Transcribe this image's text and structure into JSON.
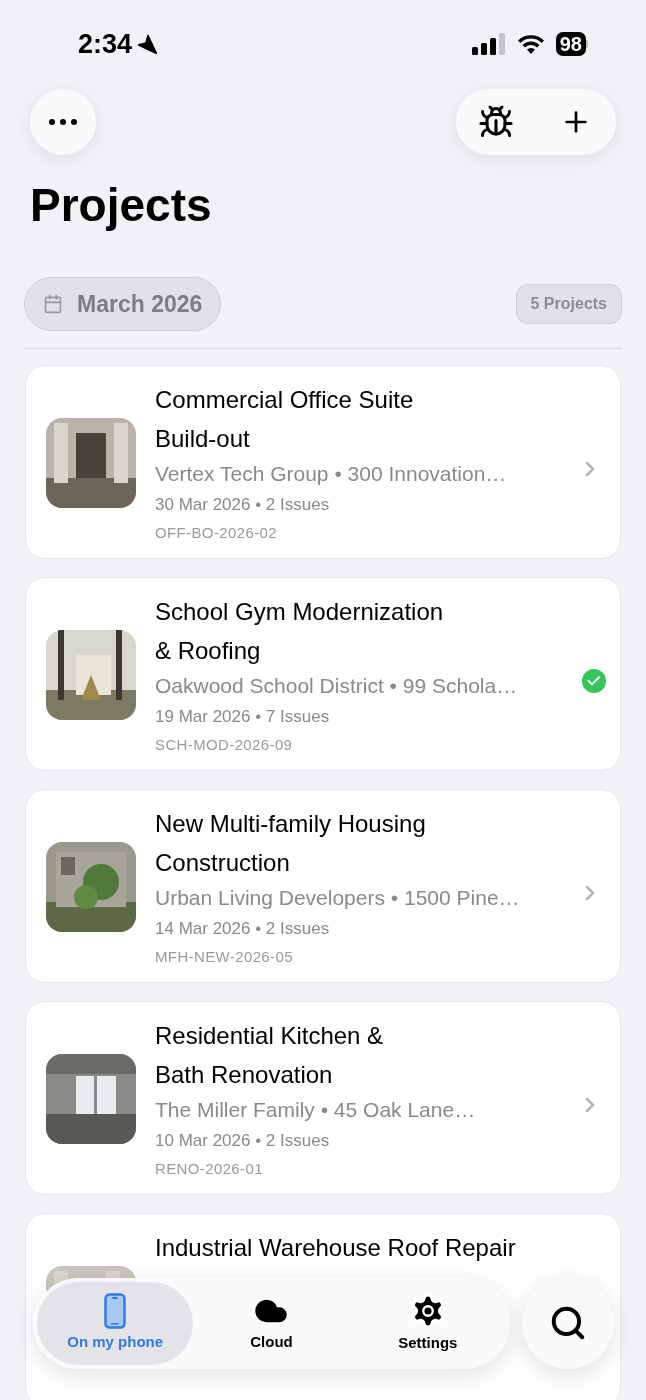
{
  "status_bar": {
    "time": "2:34",
    "battery": "98"
  },
  "title": "Projects",
  "filter": {
    "month": "March 2026",
    "count": "5 Projects"
  },
  "projects": [
    {
      "title": [
        "Commercial Office Suite",
        "Build-out"
      ],
      "subtitle": "Vertex Tech Group • 300 Innovation…",
      "meta": "30 Mar 2026 • 2 Issues",
      "code": "OFF-BO-2026-02",
      "completed": false
    },
    {
      "title": [
        "School Gym Modernization",
        "& Roofing"
      ],
      "subtitle": "Oakwood School District • 99 Schola…",
      "meta": "19 Mar 2026 • 7 Issues",
      "code": "SCH-MOD-2026-09",
      "completed": true
    },
    {
      "title": [
        "New Multi-family Housing",
        "Construction"
      ],
      "subtitle": "Urban Living Developers • 1500 Pine…",
      "meta": "14 Mar 2026 • 2 Issues",
      "code": "MFH-NEW-2026-05",
      "completed": false
    },
    {
      "title": [
        "Residential Kitchen &",
        "Bath Renovation"
      ],
      "subtitle": "The Miller Family • 45 Oak Lane…",
      "meta": "10 Mar 2026 • 2 Issues",
      "code": "RENO-2026-01",
      "completed": false
    },
    {
      "title": [
        "Industrial Warehouse Roof Repair"
      ]
    }
  ],
  "tab_bar": [
    {
      "label": "On my phone",
      "kind": "phone",
      "selected": true
    },
    {
      "label": "Cloud",
      "kind": "cloud",
      "selected": false
    },
    {
      "label": "Settings",
      "kind": "settings",
      "selected": false
    }
  ]
}
